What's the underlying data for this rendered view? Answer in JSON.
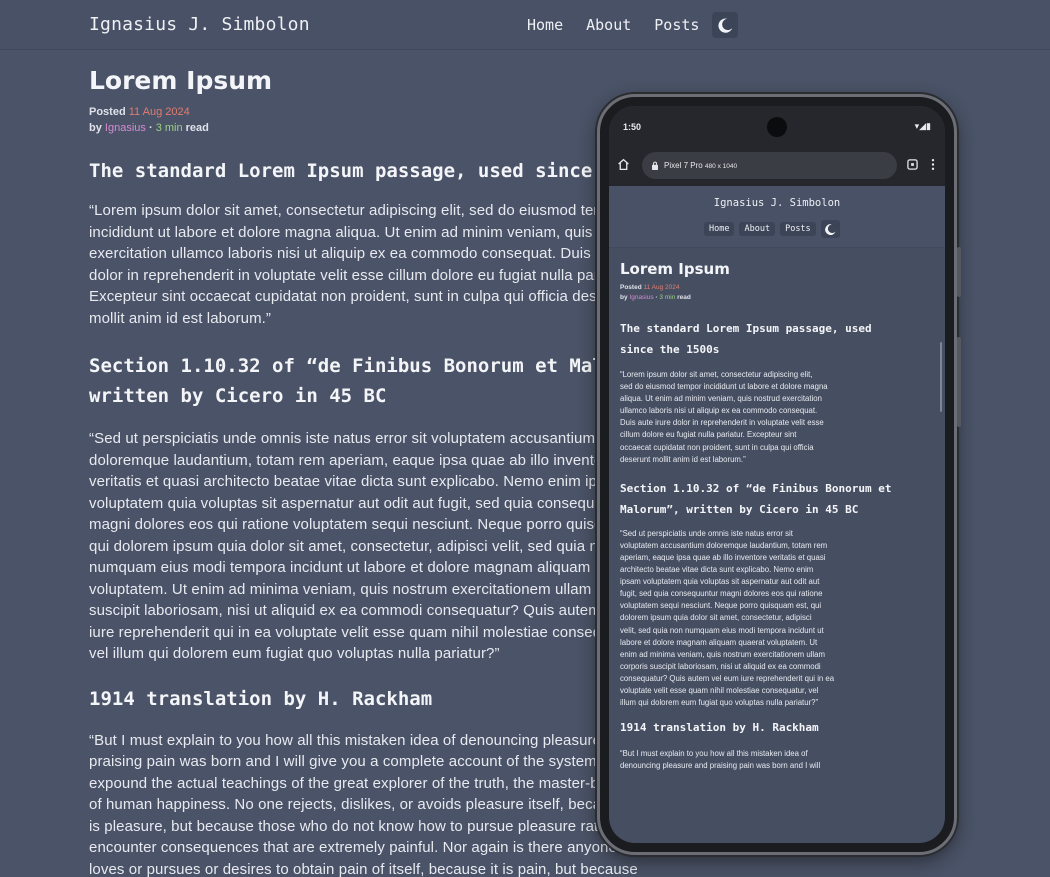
{
  "header": {
    "site_title": "Ignasius J. Simbolon",
    "nav": [
      {
        "label": "Home"
      },
      {
        "label": "About"
      },
      {
        "label": "Posts"
      }
    ],
    "theme_icon": "moon-icon"
  },
  "article": {
    "title": "Lorem Ipsum",
    "posted_label": "Posted",
    "date": "11 Aug 2024",
    "by_label": "by",
    "author": "Ignasius",
    "separator": "·",
    "read_time": "3 min",
    "read_label": "read",
    "sections": [
      {
        "heading": "The standard Lorem Ipsum passage, used since the 1500s",
        "lines": [
          "“Lorem ipsum dolor sit amet, consectetur adipiscing elit, sed do eiusmod tempor",
          "incididunt ut labore et dolore magna aliqua. Ut enim ad minim veniam, quis nostrud",
          "exercitation ullamco laboris nisi ut aliquip ex ea commodo consequat. Duis aute irure",
          "dolor in reprehenderit in voluptate velit esse cillum dolore eu fugiat nulla pariatur.",
          "Excepteur sint occaecat cupidatat non proident, sunt in culpa qui officia deserunt",
          "mollit anim id est laborum.”"
        ]
      },
      {
        "heading_lines": [
          "Section 1.10.32 of “de Finibus Bonorum et Malorum”,",
          "written by Cicero in 45 BC"
        ],
        "lines": [
          "“Sed ut perspiciatis unde omnis iste natus error sit voluptatem accusantium",
          "doloremque laudantium, totam rem aperiam, eaque ipsa quae ab illo inventore",
          "veritatis et quasi architecto beatae vitae dicta sunt explicabo. Nemo enim ipsam",
          "voluptatem quia voluptas sit aspernatur aut odit aut fugit, sed quia consequuntur",
          "magni dolores eos qui ratione voluptatem sequi nesciunt. Neque porro quisquam est,",
          "qui dolorem ipsum quia dolor sit amet, consectetur, adipisci velit, sed quia non",
          "numquam eius modi tempora incidunt ut labore et dolore magnam aliquam quaerat",
          "voluptatem. Ut enim ad minima veniam, quis nostrum exercitationem ullam corporis",
          "suscipit laboriosam, nisi ut aliquid ex ea commodi consequatur? Quis autem vel eum",
          "iure reprehenderit qui in ea voluptate velit esse quam nihil molestiae consequatur,",
          "vel illum qui dolorem eum fugiat quo voluptas nulla pariatur?”"
        ]
      },
      {
        "heading": "1914 translation by H. Rackham",
        "lines": [
          "“But I must explain to you how all this mistaken idea of denouncing pleasure and",
          "praising pain was born and I will give you a complete account of the system, and",
          "expound the actual teachings of the great explorer of the truth, the master-builder",
          "of human happiness. No one rejects, dislikes, or avoids pleasure itself, because it",
          "is pleasure, but because those who do not know how to pursue pleasure rationally",
          "encounter consequences that are extremely painful. Nor again is there anyone who",
          "loves or pursues or desires to obtain pain of itself, because it is pain, but because"
        ]
      }
    ]
  },
  "phone": {
    "status_time": "1:50",
    "status_icons": "▾◢▮",
    "url_text": "Pixel 7 Pro",
    "url_dims": "480 x 1040",
    "mobile_sections": [
      {
        "heading_lines": [
          "The standard Lorem Ipsum passage, used",
          "since the 1500s"
        ],
        "lines": [
          "“Lorem ipsum dolor sit amet, consectetur adipiscing elit,",
          "sed do eiusmod tempor incididunt ut labore et dolore magna",
          "aliqua. Ut enim ad minim veniam, quis nostrud exercitation",
          "ullamco laboris nisi ut aliquip ex ea commodo consequat.",
          "Duis aute irure dolor in reprehenderit in voluptate velit esse",
          "cillum dolore eu fugiat nulla pariatur. Excepteur sint",
          "occaecat cupidatat non proident, sunt in culpa qui officia",
          "deserunt mollit anim id est laborum.”"
        ]
      },
      {
        "heading_lines": [
          "Section 1.10.32 of “de Finibus Bonorum et",
          "Malorum”, written by Cicero in 45 BC"
        ],
        "lines": [
          "“Sed ut perspiciatis unde omnis iste natus error sit",
          "voluptatem accusantium doloremque laudantium, totam rem",
          "aperiam, eaque ipsa quae ab illo inventore veritatis et quasi",
          "architecto beatae vitae dicta sunt explicabo. Nemo enim",
          "ipsam voluptatem quia voluptas sit aspernatur aut odit aut",
          "fugit, sed quia consequuntur magni dolores eos qui ratione",
          "voluptatem sequi nesciunt. Neque porro quisquam est, qui",
          "dolorem ipsum quia dolor sit amet, consectetur, adipisci",
          "velit, sed quia non numquam eius modi tempora incidunt ut",
          "labore et dolore magnam aliquam quaerat voluptatem. Ut",
          "enim ad minima veniam, quis nostrum exercitationem ullam",
          "corporis suscipit laboriosam, nisi ut aliquid ex ea commodi",
          "consequatur? Quis autem vel eum iure reprehenderit qui in ea",
          "voluptate velit esse quam nihil molestiae consequatur, vel",
          "illum qui dolorem eum fugiat quo voluptas nulla pariatur?”"
        ]
      },
      {
        "heading_lines": [
          "1914 translation by H. Rackham"
        ],
        "lines": [
          "“But I must explain to you how all this mistaken idea of",
          "denouncing pleasure and praising pain was born and I will"
        ]
      }
    ]
  },
  "colors": {
    "background": "#4a5367",
    "date": "#e07d70",
    "author": "#d48bd0",
    "read_time": "#9ccf84"
  }
}
